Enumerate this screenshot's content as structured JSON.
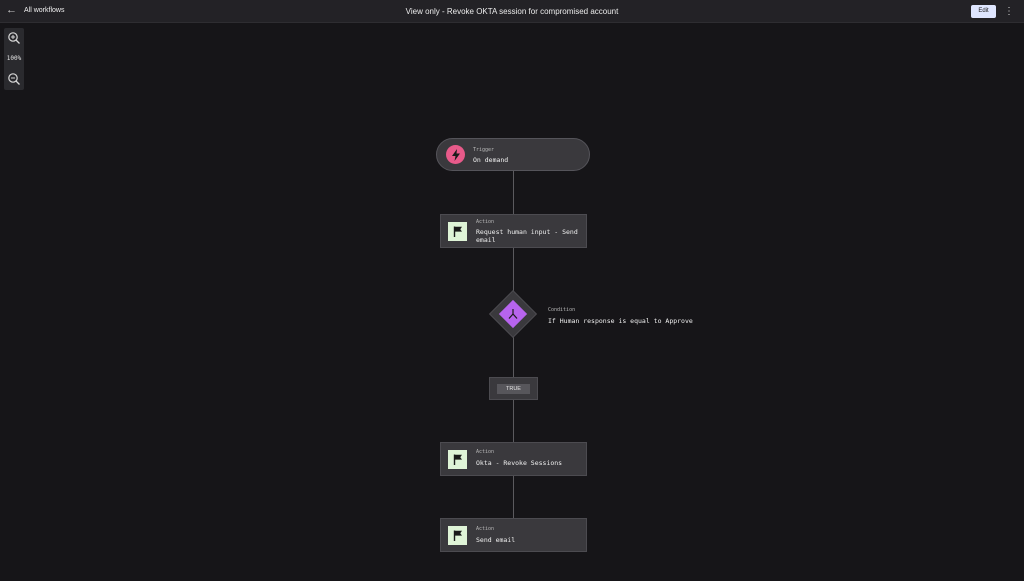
{
  "header": {
    "back_label": "All workflows",
    "title": "View only - Revoke OKTA session for compromised account",
    "edit_label": "Edit",
    "more_label": "⋮"
  },
  "zoom": {
    "level": "100%"
  },
  "workflow": {
    "trigger": {
      "kind": "Trigger",
      "label": "On demand"
    },
    "action1": {
      "kind": "Action",
      "label_line1": "Request human input - Send",
      "label_line2": "email"
    },
    "condition": {
      "kind": "Condition",
      "label": "If Human response is equal to Approve"
    },
    "branch": {
      "label": "TRUE"
    },
    "action2": {
      "kind": "Action",
      "label": "Okta - Revoke Sessions"
    },
    "action3": {
      "kind": "Action",
      "label": "Send email"
    }
  },
  "colors": {
    "background": "#161518",
    "trigger_icon": "#e85a8a",
    "condition_icon": "#b764ee",
    "action_icon": "#dff4d7",
    "edit_button": "#dfe6ff"
  }
}
